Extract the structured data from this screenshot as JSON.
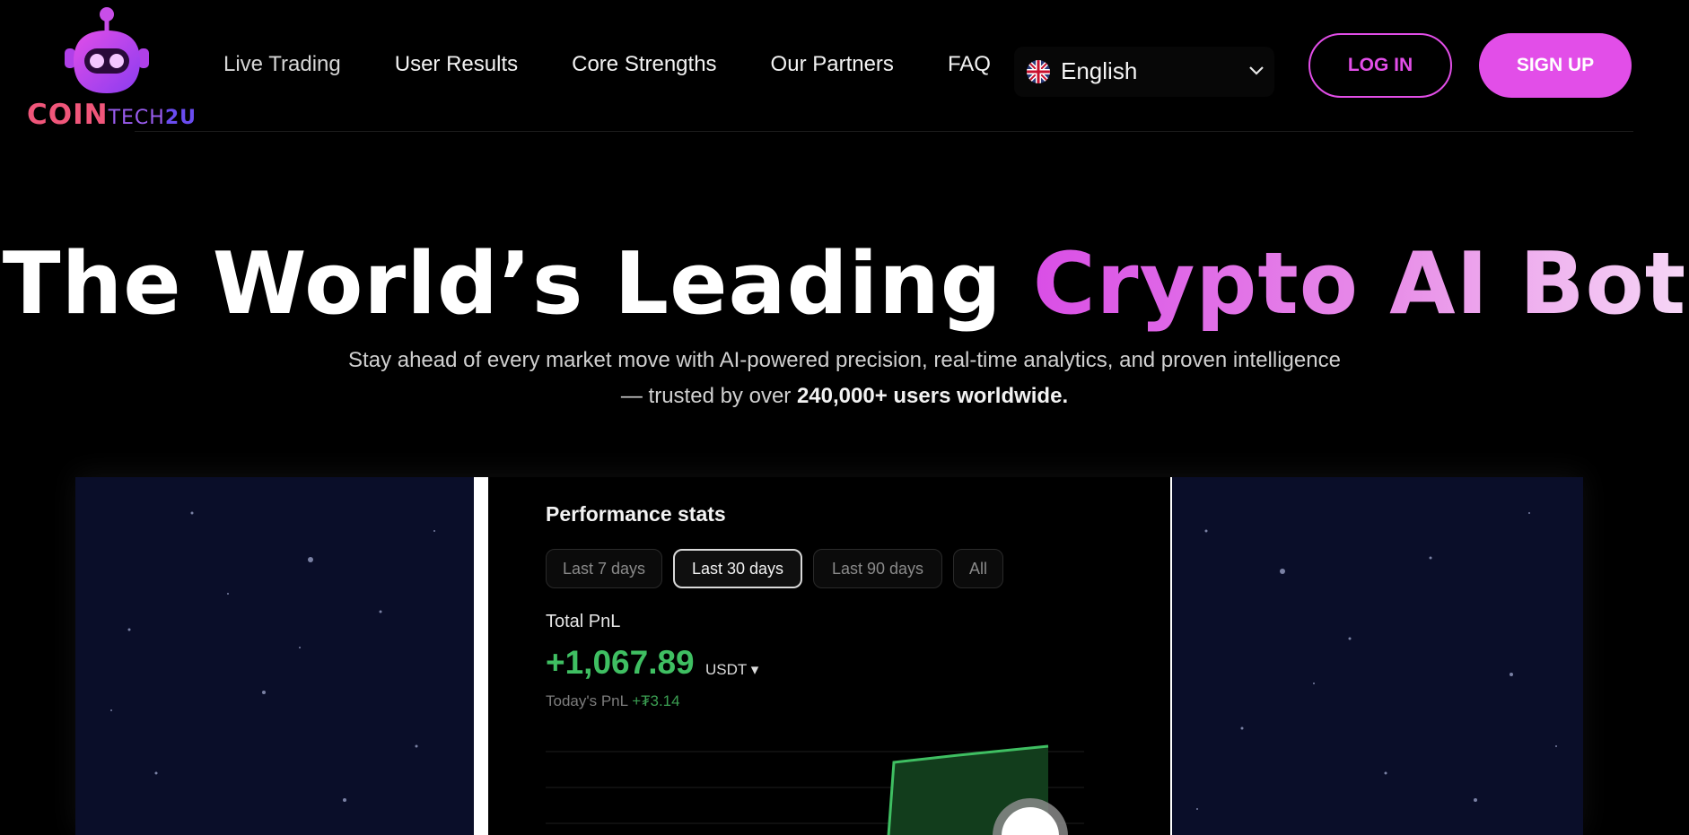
{
  "brand": {
    "logo_word_1": "COIN",
    "logo_word_2": "TECH",
    "logo_word_3": "2U",
    "colors": {
      "primary": "#e24ee8",
      "coin": "#f0567a",
      "tech": "#9a5cf0"
    }
  },
  "nav": {
    "items": [
      "Live Trading",
      "User Results",
      "Core Strengths",
      "Our Partners",
      "FAQ"
    ]
  },
  "language": {
    "selected": "English",
    "flag_icon": "uk-flag-icon",
    "chevron_icon": "chevron-down-icon"
  },
  "auth": {
    "login_label": "LOG IN",
    "signup_label": "SIGN UP"
  },
  "hero": {
    "title_plain": "The World’s Leading ",
    "title_accent": "Crypto AI Bot",
    "subtitle_line1": "Stay ahead of every market move with AI-powered precision, real-time analytics, and proven intelligence",
    "subtitle_line2_prefix": "— trusted by over ",
    "subtitle_line2_bold": "240,000+ users worldwide."
  },
  "video": {
    "panel_title": "Performance stats",
    "ranges": [
      "Last 7 days",
      "Last 30 days",
      "Last 90 days",
      "All"
    ],
    "active_range": "Last 30 days",
    "total_pnl_label": "Total PnL",
    "total_pnl_value": "+1,067.89",
    "total_pnl_unit": "USDT ▾",
    "today_label": "Today's PnL",
    "today_value": "+₮3.14",
    "pnl_color": "#3fbf62"
  }
}
